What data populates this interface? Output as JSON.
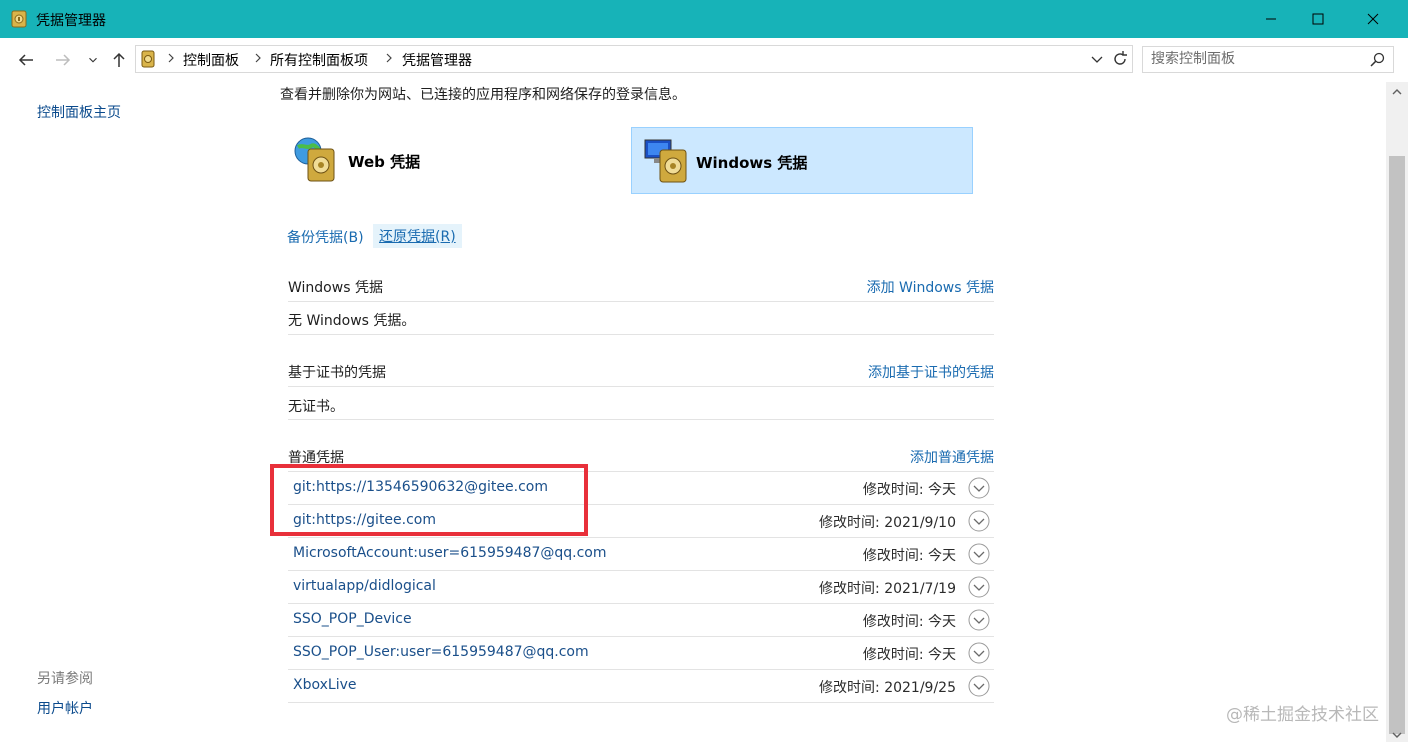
{
  "window": {
    "title": "凭据管理器",
    "accent": "#17b3b8"
  },
  "address": {
    "crumbs": [
      "控制面板",
      "所有控制面板项",
      "凭据管理器"
    ]
  },
  "search": {
    "placeholder": "搜索控制面板"
  },
  "left_pane": {
    "home_link": "控制面板主页",
    "see_also_label": "另请参阅",
    "user_accounts_link": "用户帐户"
  },
  "main": {
    "description": "查看并删除你为网站、已连接的应用程序和网络保存的登录信息。",
    "tiles": [
      {
        "label": "Web 凭据",
        "selected": false
      },
      {
        "label": "Windows 凭据",
        "selected": true
      }
    ],
    "backup_link": "备份凭据(B)",
    "restore_link": "还原凭据(R)",
    "windows_section": {
      "title": "Windows 凭据",
      "add_link": "添加 Windows 凭据",
      "empty_text": "无 Windows 凭据。"
    },
    "cert_section": {
      "title": "基于证书的凭据",
      "add_link": "添加基于证书的凭据",
      "empty_text": "无证书。"
    },
    "generic_section": {
      "title": "普通凭据",
      "add_link": "添加普通凭据",
      "items": [
        {
          "name": "git:https://13546590632@gitee.com",
          "modified": "修改时间:  今天"
        },
        {
          "name": "git:https://gitee.com",
          "modified": "修改时间:  2021/9/10"
        },
        {
          "name": "MicrosoftAccount:user=615959487@qq.com",
          "modified": "修改时间:  今天"
        },
        {
          "name": "virtualapp/didlogical",
          "modified": "修改时间:  2021/7/19"
        },
        {
          "name": "SSO_POP_Device",
          "modified": "修改时间:  今天"
        },
        {
          "name": "SSO_POP_User:user=615959487@qq.com",
          "modified": "修改时间:  今天"
        },
        {
          "name": "XboxLive",
          "modified": "修改时间:  2021/9/25"
        }
      ]
    }
  },
  "watermark": "@稀土掘金技术社区",
  "highlight_color": "#e8303a"
}
